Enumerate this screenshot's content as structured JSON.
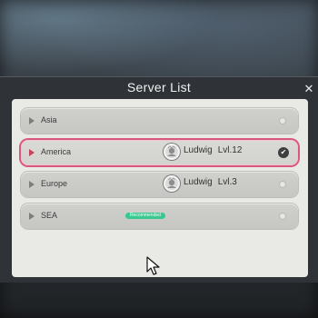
{
  "dialog": {
    "title": "Server List",
    "close_icon": "close-icon"
  },
  "servers": [
    {
      "name": "Asia",
      "selected": false
    },
    {
      "name": "America",
      "selected": true,
      "player": "Ludwig",
      "level": "Lvl.12"
    },
    {
      "name": "Europe",
      "selected": false,
      "player": "Ludwig",
      "level": "Lvl.3"
    },
    {
      "name": "SEA",
      "selected": false,
      "badge": "Recommended"
    }
  ],
  "colors": {
    "selected_outline": "#d8577c",
    "recommended_badge": "#39c88e",
    "panel": "#2f3236",
    "list_bg": "#e9e9e6"
  }
}
